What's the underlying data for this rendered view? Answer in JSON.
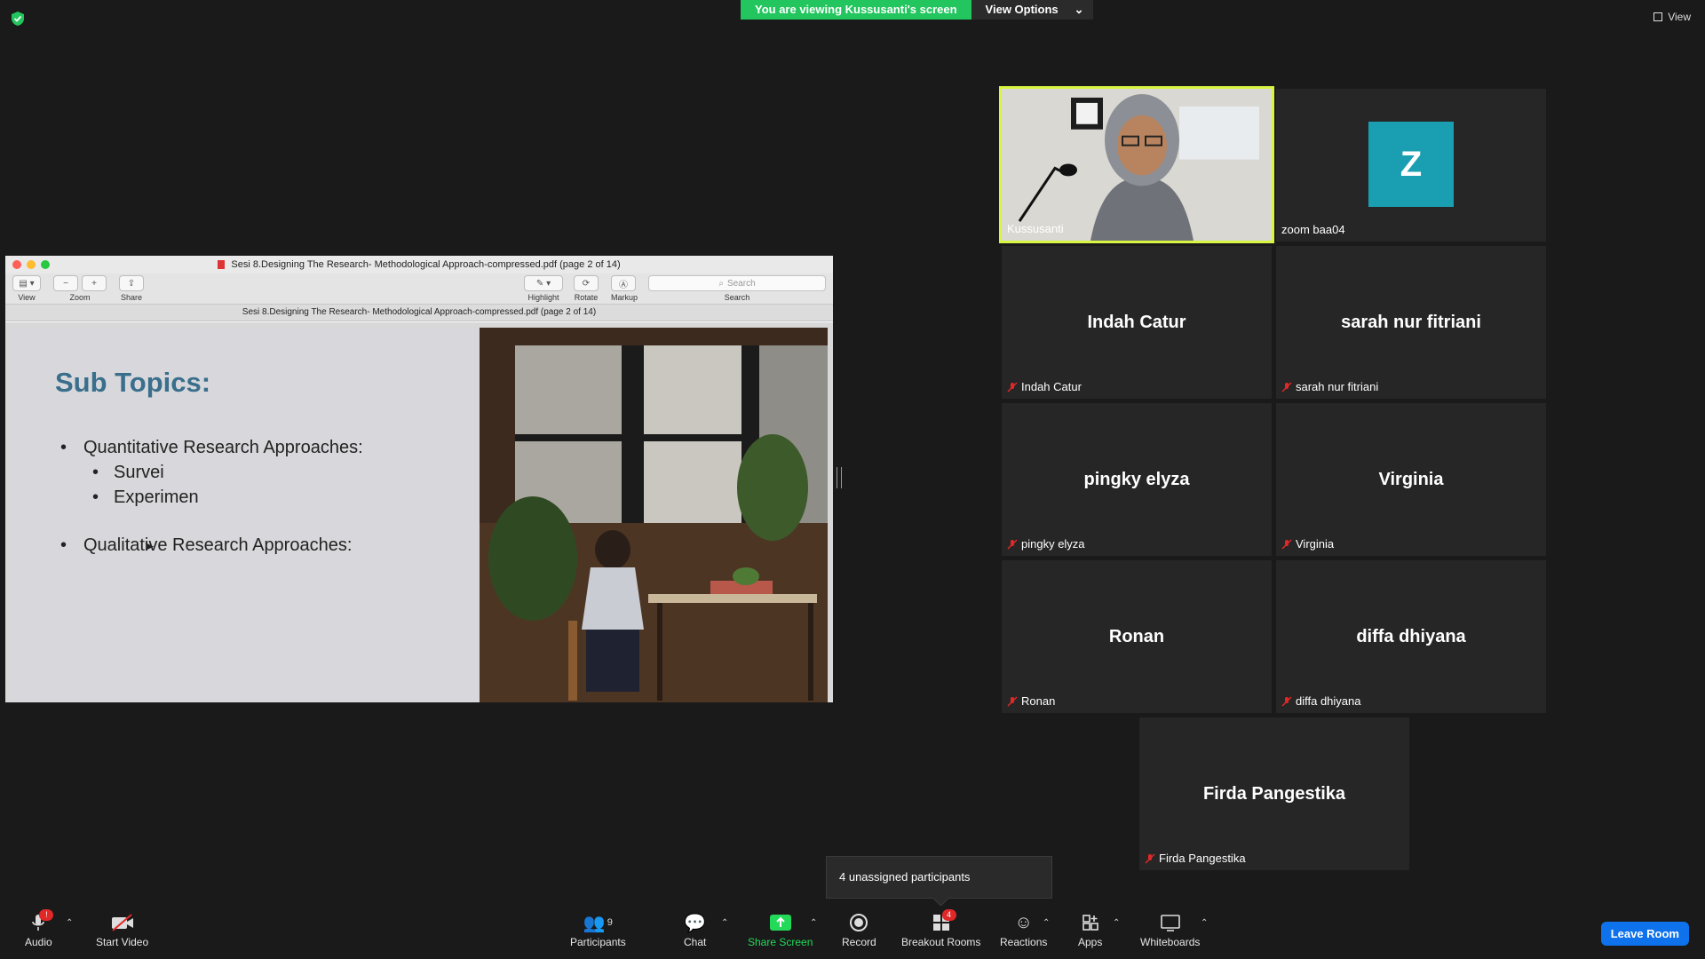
{
  "top": {
    "banner_text": "You are viewing Kussusanti's screen",
    "view_options": "View Options",
    "view_label": "View"
  },
  "share": {
    "window_title": "Sesi 8.Designing The Research- Methodological Approach-compressed.pdf (page 2 of 14)",
    "toolbar": {
      "view": "View",
      "zoom": "Zoom",
      "share": "Share",
      "highlight": "Highlight",
      "rotate": "Rotate",
      "markup": "Markup",
      "search_placeholder": "Search",
      "search": "Search"
    },
    "doc_bar": "Sesi 8.Designing The Research- Methodological Approach-compressed.pdf (page 2 of 14)",
    "slide": {
      "title": "Sub Topics:",
      "bullets": [
        "Quantitative Research Approaches:",
        "Survei",
        "Experimen",
        "Qualitative Research Approaches:"
      ]
    }
  },
  "participants": [
    {
      "name": "Kussusanti",
      "type": "video"
    },
    {
      "name": "zoom baa04",
      "initial": "Z"
    },
    {
      "name": "Indah Catur",
      "label": "Indah Catur"
    },
    {
      "name": "sarah nur fitriani",
      "label": "sarah nur fitriani"
    },
    {
      "name": "pingky elyza",
      "label": "pingky elyza"
    },
    {
      "name": "Virginia",
      "label": "Virginia"
    },
    {
      "name": "Ronan",
      "label": "Ronan"
    },
    {
      "name": "diffa dhiyana",
      "label": "diffa dhiyana"
    },
    {
      "name": "Firda Pangestika",
      "label": "Firda Pangestika"
    }
  ],
  "toast": "4 unassigned participants",
  "bottom": {
    "audio": "Audio",
    "audio_badge": "!",
    "start_video": "Start Video",
    "participants": "Participants",
    "participants_count": "9",
    "chat": "Chat",
    "share_screen": "Share Screen",
    "record": "Record",
    "breakout": "Breakout Rooms",
    "breakout_badge": "4",
    "reactions": "Reactions",
    "apps": "Apps",
    "whiteboards": "Whiteboards",
    "leave": "Leave Room"
  },
  "colors": {
    "banner_green": "#22c55e",
    "active_speaker_border": "#d7f542",
    "avatar_teal": "#1a9fb2",
    "leave_blue": "#0e72ed",
    "share_green": "#23d959",
    "muted_red": "#e02828"
  }
}
